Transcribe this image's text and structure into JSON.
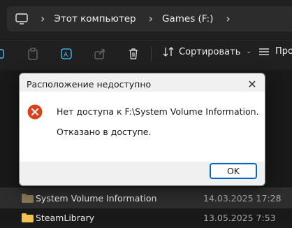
{
  "address_bar": {
    "crumbs": [
      "Этот компьютер",
      "Games (F:)"
    ]
  },
  "toolbar": {
    "sort_label": "Сортировать",
    "view_label_partial": "Про"
  },
  "files": [
    {
      "name": "System Volume Information",
      "date": "14.03.2025 17:28",
      "selected": true
    },
    {
      "name": "SteamLibrary",
      "date": "13.05.2025 7:53",
      "selected": false
    }
  ],
  "dialog": {
    "title": "Расположение недоступно",
    "message_line1": "Нет доступа к F:\\System Volume Information.",
    "message_line2": "Отказано в доступе.",
    "ok_label": "OK",
    "icon": "error-icon",
    "accent_color": "#0067c0",
    "error_color": "#d13438"
  }
}
